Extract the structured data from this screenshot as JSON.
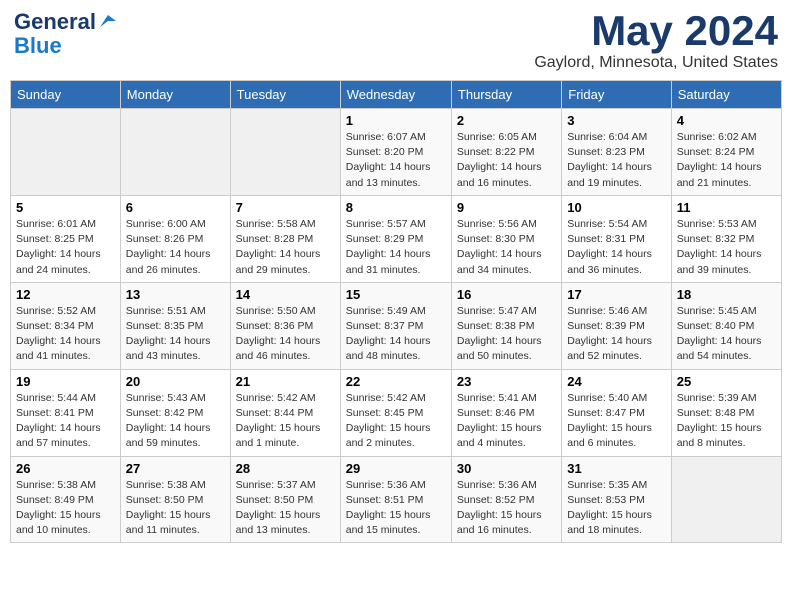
{
  "logo": {
    "text1": "General",
    "text2": "Blue"
  },
  "title": "May 2024",
  "subtitle": "Gaylord, Minnesota, United States",
  "days_of_week": [
    "Sunday",
    "Monday",
    "Tuesday",
    "Wednesday",
    "Thursday",
    "Friday",
    "Saturday"
  ],
  "weeks": [
    [
      {
        "day": "",
        "info": ""
      },
      {
        "day": "",
        "info": ""
      },
      {
        "day": "",
        "info": ""
      },
      {
        "day": "1",
        "info": "Sunrise: 6:07 AM\nSunset: 8:20 PM\nDaylight: 14 hours\nand 13 minutes."
      },
      {
        "day": "2",
        "info": "Sunrise: 6:05 AM\nSunset: 8:22 PM\nDaylight: 14 hours\nand 16 minutes."
      },
      {
        "day": "3",
        "info": "Sunrise: 6:04 AM\nSunset: 8:23 PM\nDaylight: 14 hours\nand 19 minutes."
      },
      {
        "day": "4",
        "info": "Sunrise: 6:02 AM\nSunset: 8:24 PM\nDaylight: 14 hours\nand 21 minutes."
      }
    ],
    [
      {
        "day": "5",
        "info": "Sunrise: 6:01 AM\nSunset: 8:25 PM\nDaylight: 14 hours\nand 24 minutes."
      },
      {
        "day": "6",
        "info": "Sunrise: 6:00 AM\nSunset: 8:26 PM\nDaylight: 14 hours\nand 26 minutes."
      },
      {
        "day": "7",
        "info": "Sunrise: 5:58 AM\nSunset: 8:28 PM\nDaylight: 14 hours\nand 29 minutes."
      },
      {
        "day": "8",
        "info": "Sunrise: 5:57 AM\nSunset: 8:29 PM\nDaylight: 14 hours\nand 31 minutes."
      },
      {
        "day": "9",
        "info": "Sunrise: 5:56 AM\nSunset: 8:30 PM\nDaylight: 14 hours\nand 34 minutes."
      },
      {
        "day": "10",
        "info": "Sunrise: 5:54 AM\nSunset: 8:31 PM\nDaylight: 14 hours\nand 36 minutes."
      },
      {
        "day": "11",
        "info": "Sunrise: 5:53 AM\nSunset: 8:32 PM\nDaylight: 14 hours\nand 39 minutes."
      }
    ],
    [
      {
        "day": "12",
        "info": "Sunrise: 5:52 AM\nSunset: 8:34 PM\nDaylight: 14 hours\nand 41 minutes."
      },
      {
        "day": "13",
        "info": "Sunrise: 5:51 AM\nSunset: 8:35 PM\nDaylight: 14 hours\nand 43 minutes."
      },
      {
        "day": "14",
        "info": "Sunrise: 5:50 AM\nSunset: 8:36 PM\nDaylight: 14 hours\nand 46 minutes."
      },
      {
        "day": "15",
        "info": "Sunrise: 5:49 AM\nSunset: 8:37 PM\nDaylight: 14 hours\nand 48 minutes."
      },
      {
        "day": "16",
        "info": "Sunrise: 5:47 AM\nSunset: 8:38 PM\nDaylight: 14 hours\nand 50 minutes."
      },
      {
        "day": "17",
        "info": "Sunrise: 5:46 AM\nSunset: 8:39 PM\nDaylight: 14 hours\nand 52 minutes."
      },
      {
        "day": "18",
        "info": "Sunrise: 5:45 AM\nSunset: 8:40 PM\nDaylight: 14 hours\nand 54 minutes."
      }
    ],
    [
      {
        "day": "19",
        "info": "Sunrise: 5:44 AM\nSunset: 8:41 PM\nDaylight: 14 hours\nand 57 minutes."
      },
      {
        "day": "20",
        "info": "Sunrise: 5:43 AM\nSunset: 8:42 PM\nDaylight: 14 hours\nand 59 minutes."
      },
      {
        "day": "21",
        "info": "Sunrise: 5:42 AM\nSunset: 8:44 PM\nDaylight: 15 hours\nand 1 minute."
      },
      {
        "day": "22",
        "info": "Sunrise: 5:42 AM\nSunset: 8:45 PM\nDaylight: 15 hours\nand 2 minutes."
      },
      {
        "day": "23",
        "info": "Sunrise: 5:41 AM\nSunset: 8:46 PM\nDaylight: 15 hours\nand 4 minutes."
      },
      {
        "day": "24",
        "info": "Sunrise: 5:40 AM\nSunset: 8:47 PM\nDaylight: 15 hours\nand 6 minutes."
      },
      {
        "day": "25",
        "info": "Sunrise: 5:39 AM\nSunset: 8:48 PM\nDaylight: 15 hours\nand 8 minutes."
      }
    ],
    [
      {
        "day": "26",
        "info": "Sunrise: 5:38 AM\nSunset: 8:49 PM\nDaylight: 15 hours\nand 10 minutes."
      },
      {
        "day": "27",
        "info": "Sunrise: 5:38 AM\nSunset: 8:50 PM\nDaylight: 15 hours\nand 11 minutes."
      },
      {
        "day": "28",
        "info": "Sunrise: 5:37 AM\nSunset: 8:50 PM\nDaylight: 15 hours\nand 13 minutes."
      },
      {
        "day": "29",
        "info": "Sunrise: 5:36 AM\nSunset: 8:51 PM\nDaylight: 15 hours\nand 15 minutes."
      },
      {
        "day": "30",
        "info": "Sunrise: 5:36 AM\nSunset: 8:52 PM\nDaylight: 15 hours\nand 16 minutes."
      },
      {
        "day": "31",
        "info": "Sunrise: 5:35 AM\nSunset: 8:53 PM\nDaylight: 15 hours\nand 18 minutes."
      },
      {
        "day": "",
        "info": ""
      }
    ]
  ]
}
